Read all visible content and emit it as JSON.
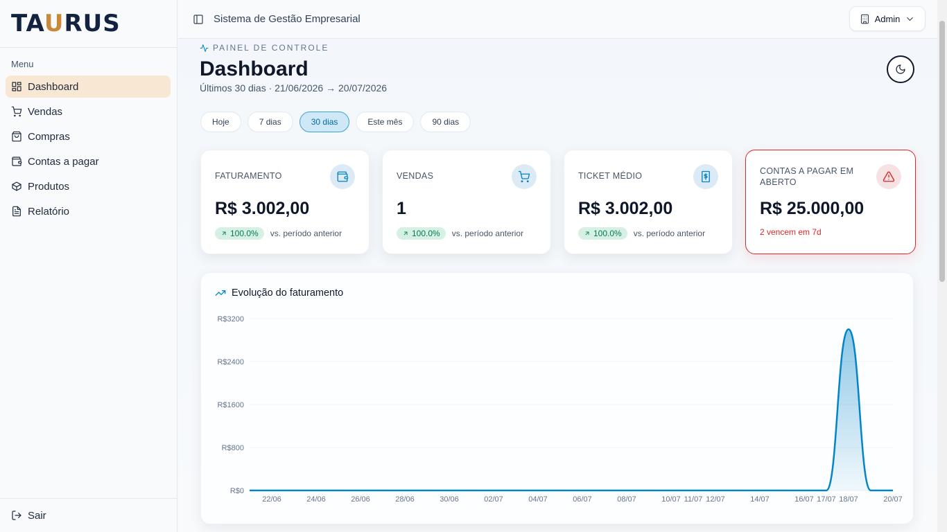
{
  "brand": {
    "logo_pre": "TA",
    "logo_accent": "U",
    "logo_post": "RUS"
  },
  "sidebar": {
    "menu_label": "Menu",
    "items": [
      {
        "label": "Dashboard",
        "icon": "dashboard-icon",
        "active": true
      },
      {
        "label": "Vendas",
        "icon": "cart-icon"
      },
      {
        "label": "Compras",
        "icon": "shopping-bag-icon"
      },
      {
        "label": "Contas a pagar",
        "icon": "wallet-icon"
      },
      {
        "label": "Produtos",
        "icon": "package-icon"
      },
      {
        "label": "Relatório",
        "icon": "file-text-icon"
      }
    ],
    "logout_label": "Sair"
  },
  "header": {
    "title": "Sistema de Gestão Empresarial",
    "user_label": "Admin"
  },
  "page": {
    "eyebrow": "PAINEL DE CONTROLE",
    "title": "Dashboard",
    "subtitle": "Últimos 30 dias · 21/06/2026 → 20/07/2026"
  },
  "filters": [
    {
      "label": "Hoje"
    },
    {
      "label": "7 dias"
    },
    {
      "label": "30 dias",
      "active": true
    },
    {
      "label": "Este mês"
    },
    {
      "label": "90 dias"
    }
  ],
  "cards": [
    {
      "label": "FATURAMENTO",
      "value": "R$ 3.002,00",
      "badge": "100.0%",
      "note": "vs. período anterior"
    },
    {
      "label": "VENDAS",
      "value": "1",
      "badge": "100.0%",
      "note": "vs. período anterior"
    },
    {
      "label": "TICKET MÉDIO",
      "value": "R$ 3.002,00",
      "badge": "100.0%",
      "note": "vs. período anterior"
    },
    {
      "label": "CONTAS A PAGAR EM ABERTO",
      "value": "R$ 25.000,00",
      "note": "2 vencem em 7d"
    }
  ],
  "colors": {
    "accent": "#0284c7",
    "danger": "#dc2626",
    "active_nav": "#f8e7d2"
  },
  "chart_title": "Evolução do faturamento",
  "chart_data": {
    "type": "area",
    "title": "Evolução do faturamento",
    "y_tick_labels": [
      "R$0",
      "R$800",
      "R$1600",
      "R$2400",
      "R$3200"
    ],
    "y_ticks": [
      0,
      800,
      1600,
      2400,
      3200
    ],
    "ylim": [
      0,
      3200
    ],
    "x_tick_labels": [
      "22/06",
      "24/06",
      "26/06",
      "28/06",
      "30/06",
      "02/07",
      "04/07",
      "06/07",
      "08/07",
      "10/07",
      "11/07",
      "12/07",
      "14/07",
      "16/07",
      "17/07",
      "18/07",
      "20/07"
    ],
    "x": [
      "21/06",
      "22/06",
      "23/06",
      "24/06",
      "25/06",
      "26/06",
      "27/06",
      "28/06",
      "29/06",
      "30/06",
      "01/07",
      "02/07",
      "03/07",
      "04/07",
      "05/07",
      "06/07",
      "07/07",
      "08/07",
      "09/07",
      "10/07",
      "11/07",
      "12/07",
      "13/07",
      "14/07",
      "15/07",
      "16/07",
      "17/07",
      "18/07",
      "19/07",
      "20/07"
    ],
    "series": [
      {
        "values": [
          0,
          0,
          0,
          0,
          0,
          0,
          0,
          0,
          0,
          0,
          0,
          0,
          0,
          0,
          0,
          0,
          0,
          0,
          0,
          0,
          0,
          0,
          0,
          0,
          0,
          0,
          0,
          3002,
          0,
          0
        ]
      }
    ],
    "grid": true
  }
}
